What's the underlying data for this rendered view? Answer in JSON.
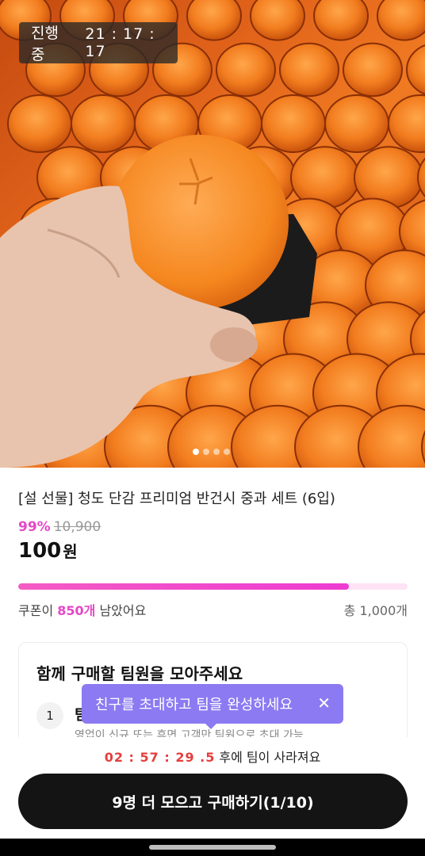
{
  "hero": {
    "badge_label": "진행중",
    "badge_time": "21 : 17 : 17",
    "image_alt_icon": "persimmon-photo",
    "carousel": {
      "count": 4,
      "active": 0
    }
  },
  "product": {
    "title": "[설 선물] 청도 단감 프리미엄 반건시 중과 세트 (6입)",
    "discount": "99%",
    "original_price": "10,900",
    "price": "100",
    "price_unit": "원"
  },
  "coupon": {
    "progress_fraction": 0.85,
    "left_prefix": "쿠폰이 ",
    "left_count": "850개",
    "left_suffix": " 남았어요",
    "total": "총 1,000개"
  },
  "team": {
    "title": "함께 구매할 팀원을 모아주세요",
    "step_number": "1",
    "step_title": "팀",
    "step_desc": "영업이 신규 또는 휴면 고객만 팀원으로 초대 가능"
  },
  "tooltip": {
    "text": "친구를 초대하고 팀을 완성하세요",
    "close_glyph": "✕"
  },
  "footer": {
    "countdown_time": "02 : 57 : 29 .5",
    "countdown_suffix": "후에 팀이 사라져요",
    "cta_label": "9명 더 모으고 구매하기(1/10)"
  },
  "colors": {
    "accent": "#e548c6",
    "tooltip": "#8c7af2",
    "cta": "#141414",
    "countdown": "#e53e3e"
  }
}
